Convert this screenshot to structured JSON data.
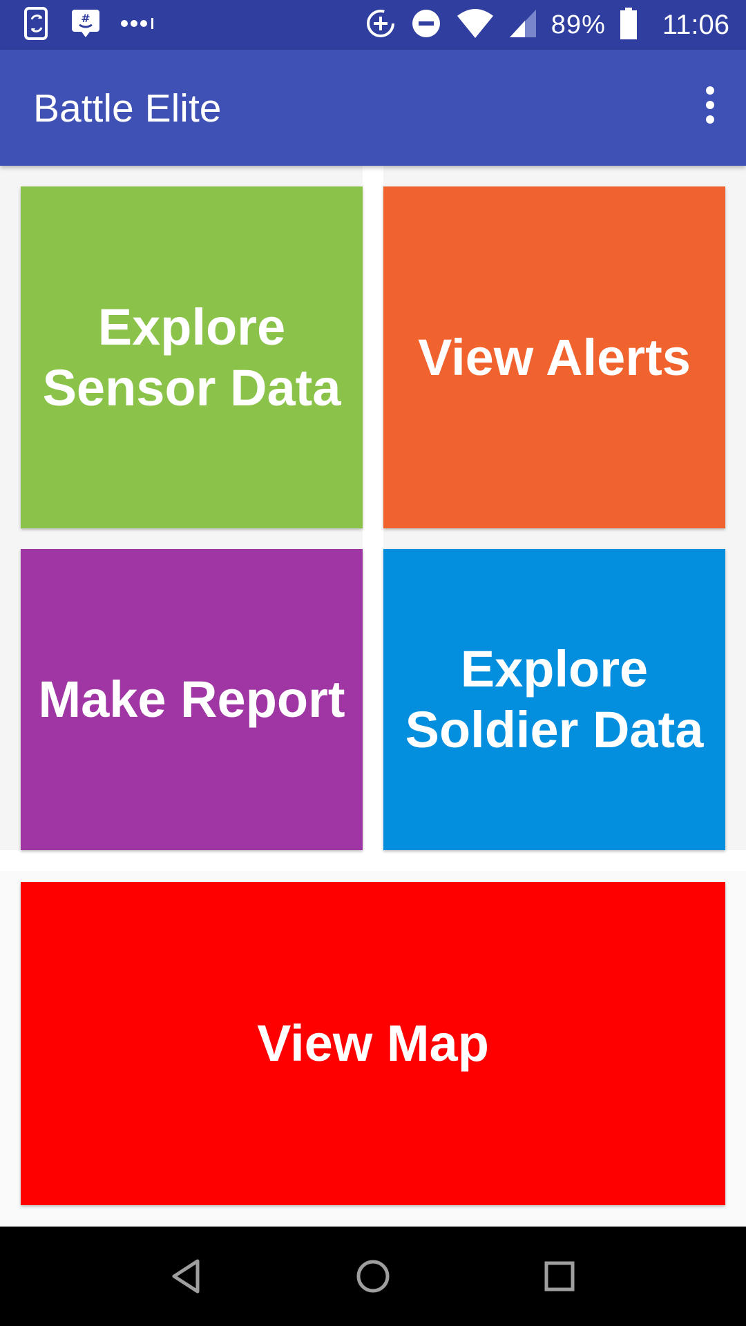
{
  "status_bar": {
    "battery_percent": "89%",
    "time": "11:06",
    "icons": [
      "phone-sync-icon",
      "hashtag-chat-icon",
      "more-notifications-icon",
      "data-saver-icon",
      "do-not-disturb-icon",
      "wifi-icon",
      "cell-signal-icon",
      "battery-icon"
    ]
  },
  "app_bar": {
    "title": "Battle Elite",
    "menu_icon": "overflow-menu-icon"
  },
  "tiles": {
    "sensor": {
      "label": "Explore\nSensor Data",
      "color": "#8bc34a"
    },
    "alerts": {
      "label": "View Alerts",
      "color": "#f1632e"
    },
    "report": {
      "label": "Make Report",
      "color": "#9f36a3"
    },
    "soldier": {
      "label": "Explore\nSoldier Data",
      "color": "#038fdd"
    },
    "map": {
      "label": "View Map",
      "color": "#ff0000"
    }
  },
  "nav_bar": {
    "icons": [
      "back-icon",
      "home-icon",
      "recents-icon"
    ]
  }
}
